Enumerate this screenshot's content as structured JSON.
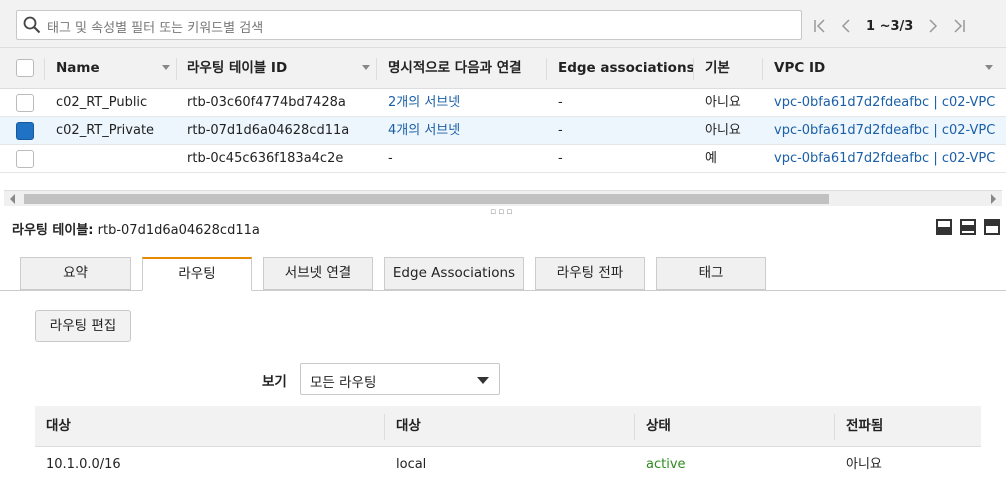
{
  "search": {
    "placeholder": "태그 및 속성별 필터 또는 키워드별 검색"
  },
  "pager": {
    "count": "1 ~3/3"
  },
  "table": {
    "columns": [
      "Name",
      "라우팅 테이블 ID",
      "명시적으로 다음과 연결",
      "Edge associations",
      "기본",
      "VPC ID"
    ],
    "rows": [
      {
        "name": "c02_RT_Public",
        "id": "rtb-03c60f4774bd7428a",
        "assoc": "2개의 서브넷",
        "edge": "-",
        "main": "아니요",
        "vpc": "vpc-0bfa61d7d2fdeafbc | c02-VPC",
        "selected": false
      },
      {
        "name": "c02_RT_Private",
        "id": "rtb-07d1d6a04628cd11a",
        "assoc": "4개의 서브넷",
        "edge": "-",
        "main": "아니요",
        "vpc": "vpc-0bfa61d7d2fdeafbc | c02-VPC",
        "selected": true
      },
      {
        "name": "",
        "id": "rtb-0c45c636f183a4c2e",
        "assoc": "-",
        "edge": "-",
        "main": "예",
        "vpc": "vpc-0bfa61d7d2fdeafbc | c02-VPC",
        "selected": false
      }
    ]
  },
  "detail": {
    "label": "라우팅 테이블:",
    "id": "rtb-07d1d6a04628cd11a",
    "tabs": [
      "요약",
      "라우팅",
      "서브넷 연결",
      "Edge Associations",
      "라우팅 전파",
      "태그"
    ],
    "active_tab": "라우팅",
    "edit_button": "라우팅 편집",
    "view_label": "보기",
    "view_value": "모든 라우팅",
    "routes_columns": [
      "대상",
      "대상",
      "상태",
      "전파됨"
    ],
    "routes": [
      {
        "destination": "10.1.0.0/16",
        "target": "local",
        "status": "active",
        "propagated": "아니요"
      }
    ]
  },
  "colors": {
    "link": "#1a5fa8",
    "active": "#2e8b1f",
    "tab_accent": "#e68a00",
    "checkbox": "#1f72c4"
  }
}
